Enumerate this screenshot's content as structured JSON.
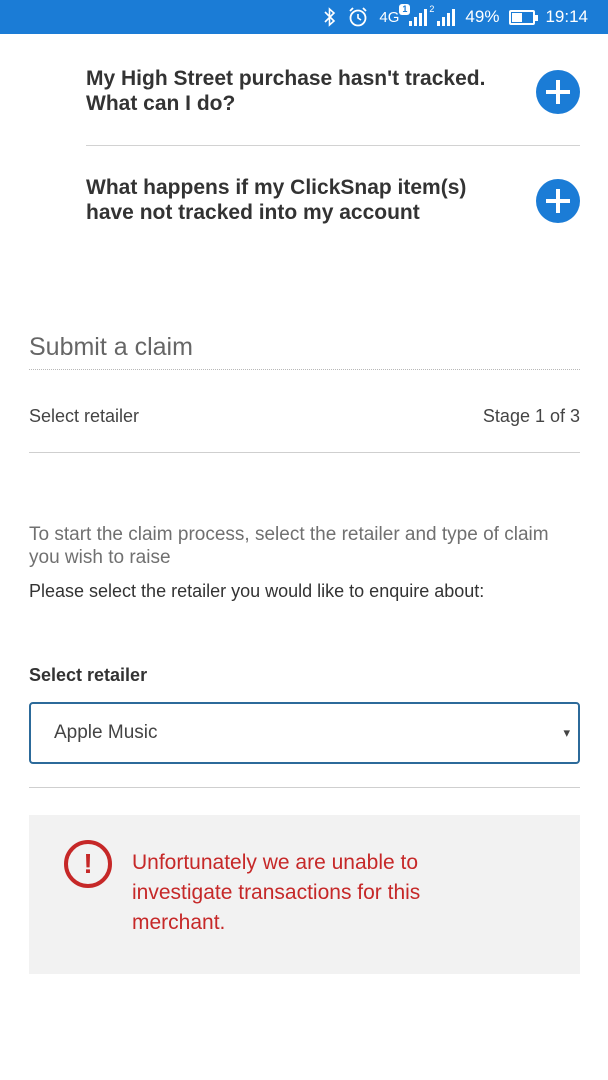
{
  "status_bar": {
    "network": "4G",
    "battery": "49%",
    "time": "19:14",
    "sim1_badge": "1",
    "sim2_badge": "2",
    "icons": [
      "bluetooth-icon",
      "alarm-icon",
      "signal-icon",
      "battery-icon"
    ],
    "battery_level": 0.49,
    "background_color": "#1b7cd6"
  },
  "faq": {
    "items": [
      {
        "question": "My High Street purchase hasn't tracked. What can I do?"
      },
      {
        "question": "What happens if my ClickSnap item(s) have not tracked into my account"
      }
    ],
    "expand_icon": "plus-icon",
    "accent_color": "#1b7cd6"
  },
  "claim": {
    "title": "Submit a claim",
    "step_label": "Select retailer",
    "stage": "Stage 1 of 3",
    "intro": "To start the claim process, select the retailer and type of claim you wish to raise",
    "instruction": "Please select the retailer you would like to enquire about:",
    "select_label": "Select retailer",
    "selected_retailer": "Apple Music",
    "select_arrow": "▾"
  },
  "error": {
    "icon": "!",
    "message": "Unfortunately we are unable to investigate transactions for this merchant.",
    "color": "#c62828"
  }
}
